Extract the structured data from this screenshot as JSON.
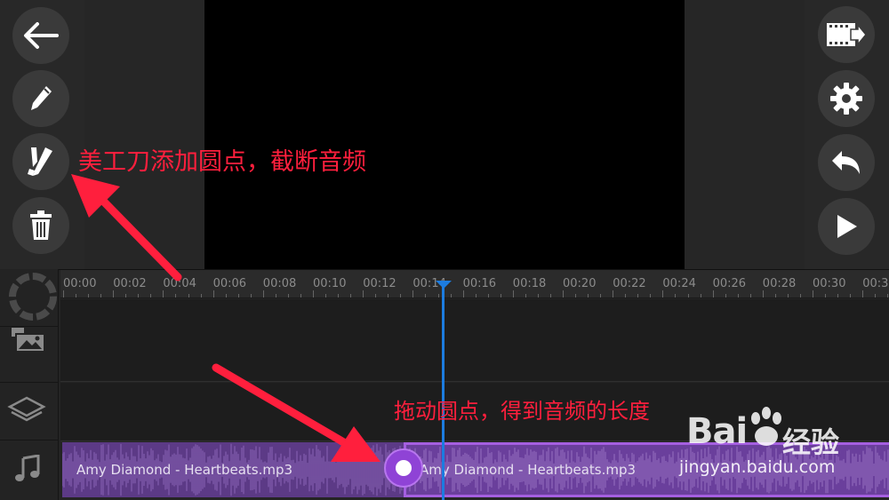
{
  "toolbar_left": {
    "icons": [
      "back-arrow-icon",
      "pencil-icon",
      "split-knife-icon",
      "trash-icon"
    ]
  },
  "toolbar_right": {
    "icons": [
      "export-film-icon",
      "gear-icon",
      "undo-icon",
      "play-icon"
    ]
  },
  "side_panel": {
    "icons": [
      "loading-spinner-icon",
      "media-icon",
      "layers-icon",
      "music-note-icon"
    ]
  },
  "ruler": {
    "labels": [
      "00:00",
      "00:02",
      "00:04",
      "00:06",
      "00:08",
      "00:10",
      "00:12",
      "00:14",
      "00:16",
      "00:18",
      "00:20",
      "00:22",
      "00:24",
      "00:26",
      "00:28",
      "00:30",
      "00:3"
    ]
  },
  "audio_track": {
    "clips": [
      {
        "label": "Amy Diamond - Heartbeats.mp3"
      },
      {
        "label": "Amy Diamond - Heartbeats.mp3"
      }
    ]
  },
  "annotations": {
    "split_tool": "美工刀添加圆点，截断音频",
    "drag_handle": "拖动圆点，得到音频的长度"
  },
  "watermark": {
    "logo": "Bai",
    "logo_suffix": "经验",
    "url": "jingyan.baidu.com"
  },
  "colors": {
    "accent_playhead": "#1c7ce0",
    "audio_clip": "#5c3a86",
    "audio_clip_selected": "#6a3f9c",
    "annotation": "#ff1f3d"
  }
}
